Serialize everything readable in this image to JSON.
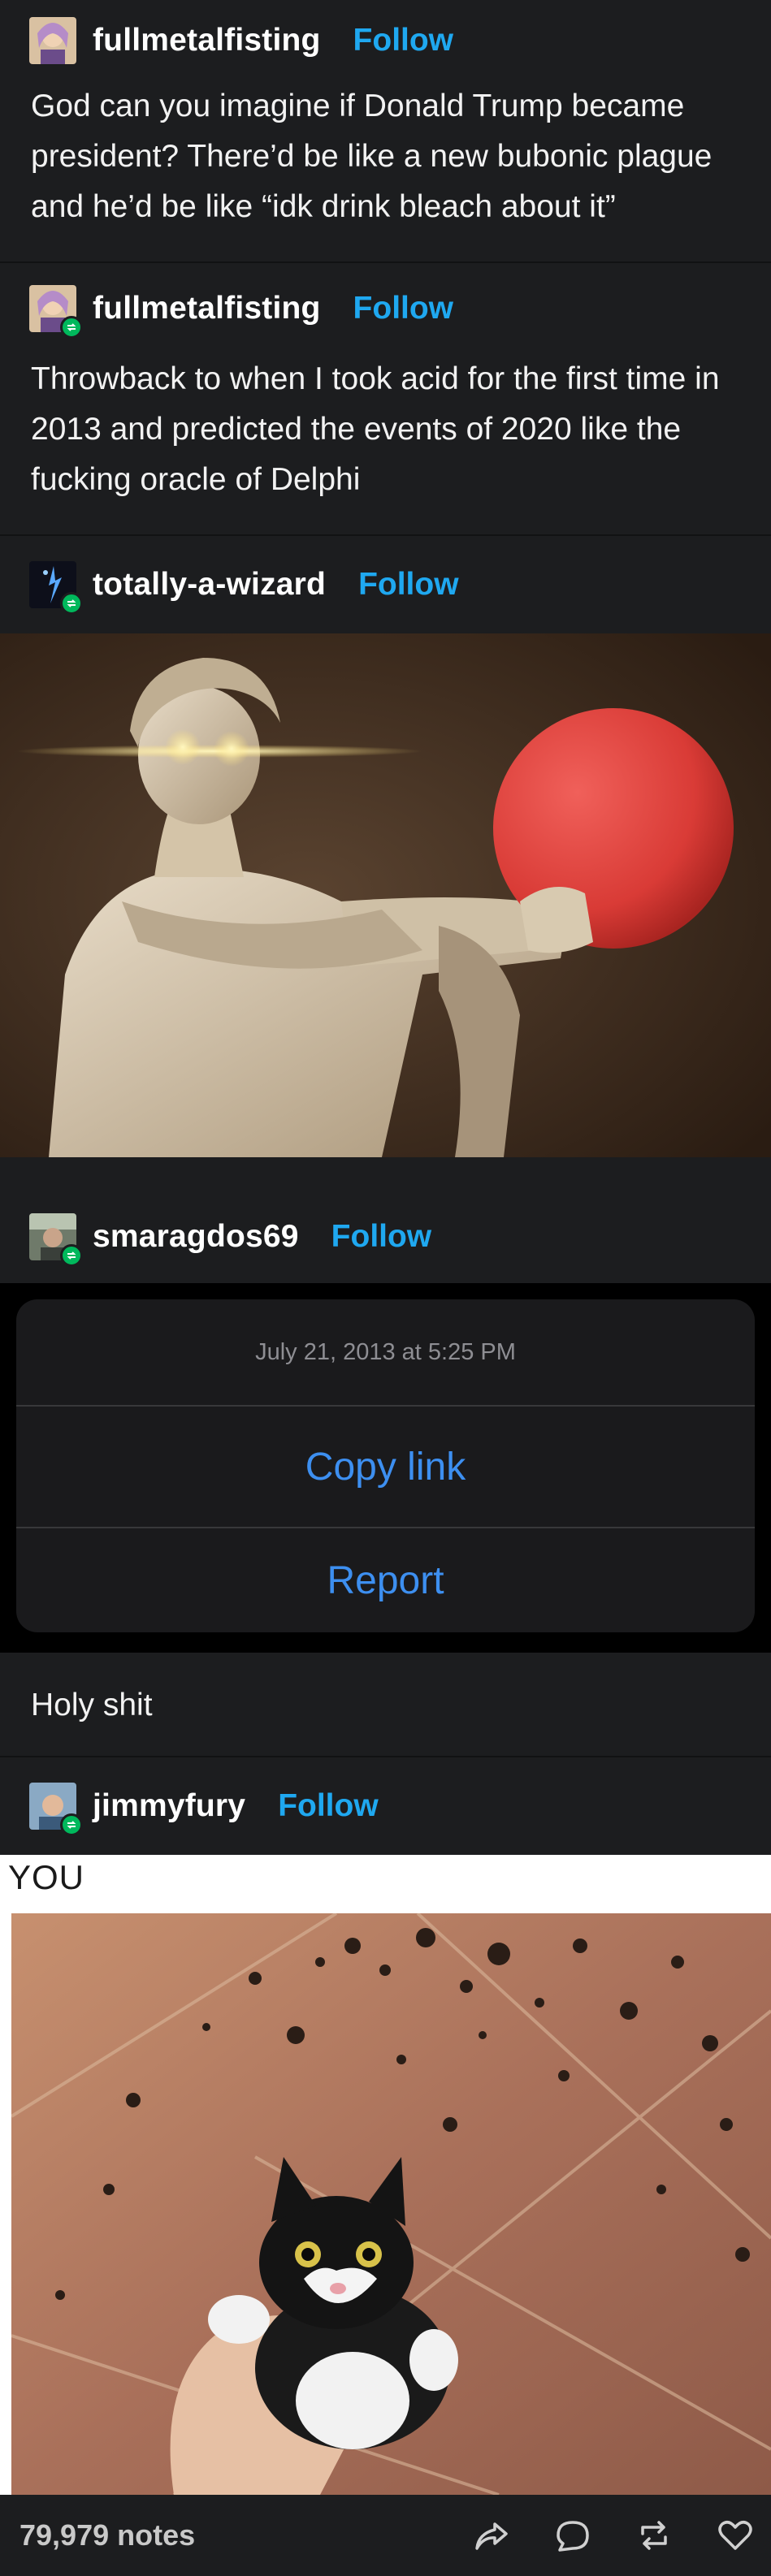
{
  "posts": [
    {
      "username": "fullmetalfisting",
      "follow": "Follow",
      "text": "God can you imagine if Donald Trump became president? There’d be like a new bubonic plague and he’d be like “idk drink bleach about it”"
    },
    {
      "username": "fullmetalfisting",
      "follow": "Follow",
      "text": "Throwback to when I took acid for the first time in 2013 and predicted the events of 2020 like the fucking oracle of Delphi"
    },
    {
      "username": "totally-a-wizard",
      "follow": "Follow"
    },
    {
      "username": "smaragdos69",
      "follow": "Follow",
      "sheet": {
        "timestamp": "July 21, 2013 at 5:25 PM",
        "copy_link": "Copy link",
        "report": "Report"
      },
      "text": "Holy shit"
    },
    {
      "username": "jimmyfury",
      "follow": "Follow",
      "meme_caption": "YOU"
    }
  ],
  "footer": {
    "notes": "79,979 notes"
  },
  "colors": {
    "background": "#1c1d1f",
    "follow": "#1fa8f0",
    "reblog_badge": "#00b85c",
    "sheet_action": "#3d8ff0"
  }
}
